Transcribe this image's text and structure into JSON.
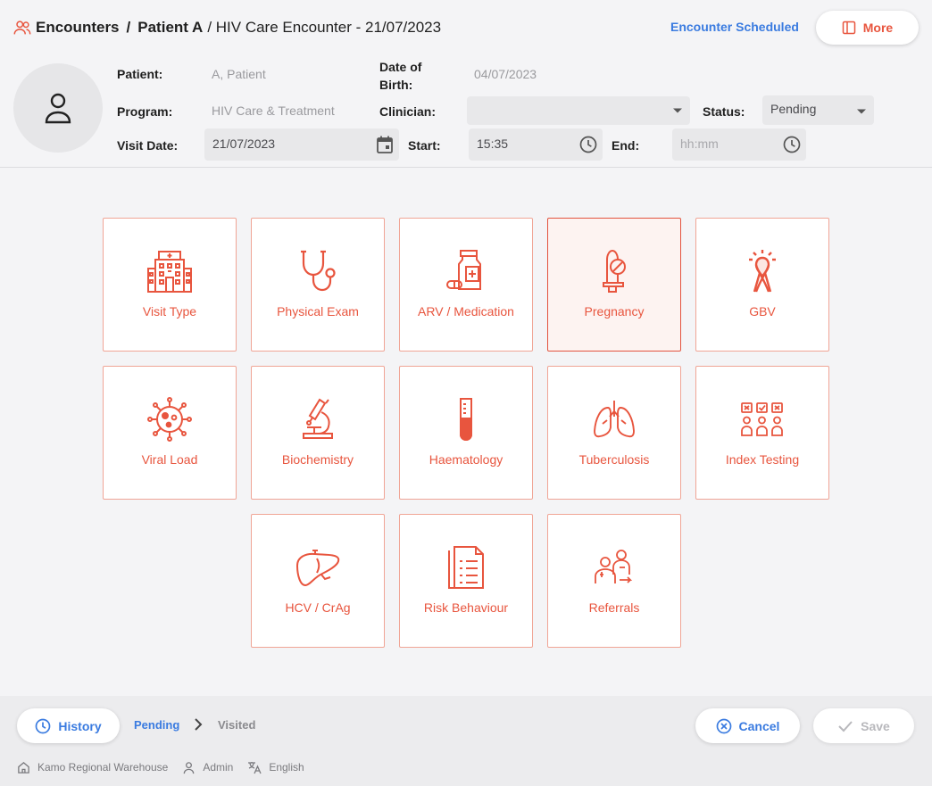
{
  "header": {
    "breadcrumb": {
      "root": "Encounters",
      "separator": "/",
      "patient": "Patient A",
      "encounter": "/ HIV Care Encounter - 21/07/2023"
    },
    "encounter_status": "Encounter Scheduled",
    "more_label": "More"
  },
  "patient_info": {
    "patient_label": "Patient:",
    "patient_value": "A, Patient",
    "dob_label_line1": "Date of",
    "dob_label_line2": "Birth:",
    "dob_value": "04/07/2023",
    "program_label": "Program:",
    "program_value": "HIV Care & Treatment",
    "clinician_label": "Clinician:",
    "clinician_value": "",
    "status_label": "Status:",
    "status_value": "Pending",
    "visit_date_label": "Visit Date:",
    "visit_date_value": "21/07/2023",
    "start_label": "Start:",
    "start_value": "15:35",
    "end_label": "End:",
    "end_placeholder": "hh:mm"
  },
  "tiles": [
    {
      "label": "Visit Type",
      "icon": "hospital-icon"
    },
    {
      "label": "Physical Exam",
      "icon": "stethoscope-icon"
    },
    {
      "label": "ARV / Medication",
      "icon": "medication-bottle-icon"
    },
    {
      "label": "Pregnancy",
      "icon": "pregnancy-test-icon",
      "selected": true
    },
    {
      "label": "GBV",
      "icon": "ribbon-icon"
    },
    {
      "label": "Viral Load",
      "icon": "virus-icon"
    },
    {
      "label": "Biochemistry",
      "icon": "microscope-icon"
    },
    {
      "label": "Haematology",
      "icon": "test-tube-icon"
    },
    {
      "label": "Tuberculosis",
      "icon": "lungs-icon"
    },
    {
      "label": "Index Testing",
      "icon": "people-testing-icon"
    },
    {
      "label": "HCV / CrAg",
      "icon": "liver-icon"
    },
    {
      "label": "Risk Behaviour",
      "icon": "checklist-icon"
    },
    {
      "label": "Referrals",
      "icon": "referral-icon"
    }
  ],
  "footer": {
    "history_label": "History",
    "steps": [
      "Pending",
      "Visited"
    ],
    "cancel_label": "Cancel",
    "save_label": "Save",
    "status_bar": {
      "location": "Kamo Regional Warehouse",
      "user": "Admin",
      "language": "English"
    }
  },
  "colors": {
    "accent": "#e8553e",
    "link_blue": "#3a7be0",
    "tile_border": "#f0a596"
  }
}
